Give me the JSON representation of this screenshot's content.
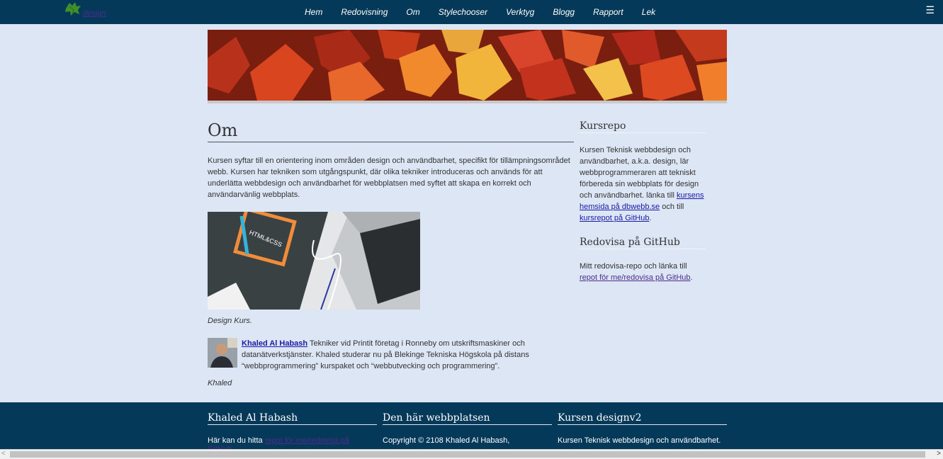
{
  "navbar": {
    "logo_text": "design",
    "items": [
      "Hem",
      "Redovisning",
      "Om",
      "Stylechooser",
      "Verktyg",
      "Blogg",
      "Rapport",
      "Lek"
    ],
    "menu_icon": "hamburger-icon",
    "background": "#04395a"
  },
  "main": {
    "title": "Om",
    "intro": "Kursen syftar till en orientering inom områden design och användbarhet, specifikt för tillämpningsområdet webb. Kursen har tekniken som utgångspunkt, där olika tekniker introduceras och används för att underlätta webbdesign och användbarhet för webbplatsen med syftet att skapa en korrekt och användarvänlig webbplats.",
    "image_caption": "Design Kurs.",
    "book_text": "HTML&CSS",
    "bio": {
      "name_link": "Khaled Al Habash",
      "text": " Tekniker vid Printit företag i Ronneby om utskriftsmaskiner och datanätverkstjänster. Khaled studerar nu på Blekinge Tekniska Högskola på distans “webbprogrammering” kurspaket och “webbutvecking och programmering”.",
      "signature": "Khaled"
    }
  },
  "sidebar": {
    "kursrepo": {
      "title": "Kursrepo",
      "text_before": "Kursen Teknisk webbdesign och användbarhet, a.k.a. design, lär webbprogrammeraren att tekniskt förbereda sin webbplats för design och användbarhet. länka till ",
      "link1": "kursens hemsida på dbwebb.se",
      "text_mid": " och till ",
      "link2": "kursrepot på GitHub",
      "text_after": "."
    },
    "redovisa": {
      "title": "Redovisa på GitHub",
      "text_before": "Mitt redovisa-repo och länka till ",
      "link": "repot för me/redovisa på GitHub",
      "text_after": "."
    }
  },
  "footer": {
    "col1": {
      "title": "Khaled Al Habash",
      "text_before": "Här kan du hitta ",
      "link": "repot för me/redovisa på GitHub",
      "text_after": "."
    },
    "col2": {
      "title": "Den här webbplatsen",
      "text": "Copyright © 2108 Khaled Al Habash,"
    },
    "col3": {
      "title": "Kursen designv2",
      "text": "Kursen Teknisk webbdesign och användbarhet."
    }
  },
  "scrollbar": {
    "left_arrow": "<",
    "right_arrow": ">"
  }
}
